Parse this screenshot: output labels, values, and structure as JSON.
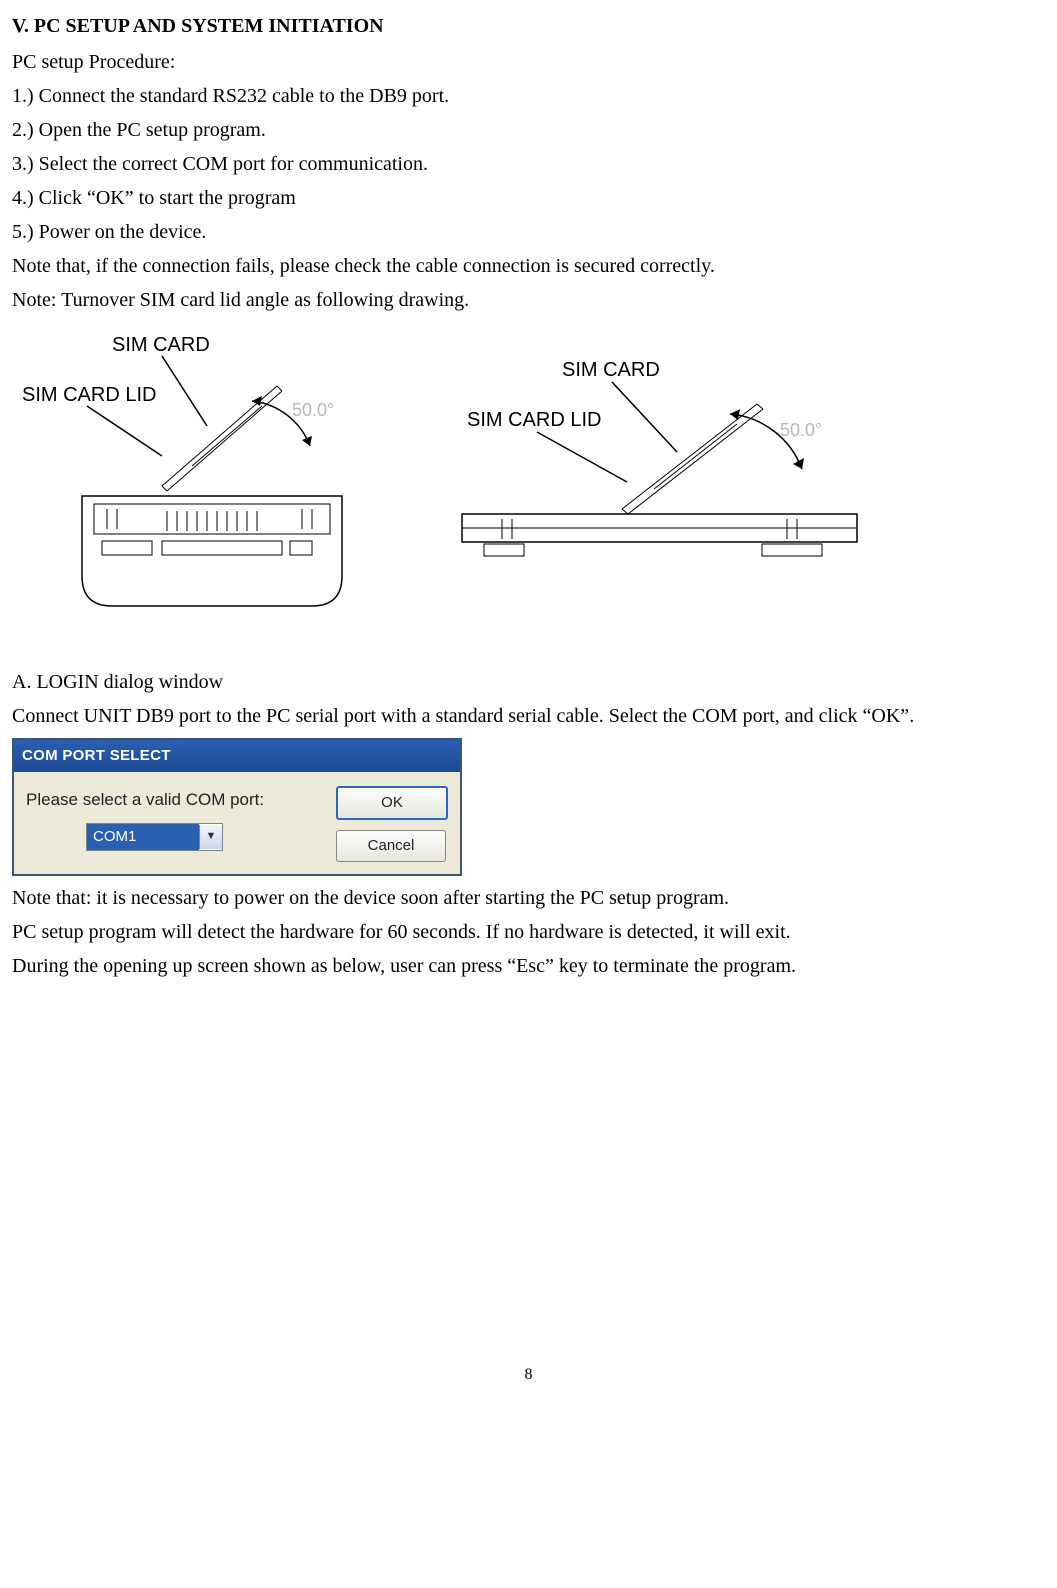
{
  "heading": "V. PC SETUP AND SYSTEM INITIATION",
  "procedure_label": "PC setup Procedure:",
  "steps": {
    "s1": "1.) Connect the standard RS232 cable to the DB9 port.",
    "s2": "2.) Open the PC setup program.",
    "s3": "3.) Select the correct COM port for communication.",
    "s4": "4.) Click “OK” to start the program",
    "s5": "5.) Power on the device."
  },
  "note1": "Note that, if the connection fails, please check the cable connection is secured correctly.",
  "note2": "Note: Turnover SIM card lid angle as following drawing.",
  "diagram_labels": {
    "sim_card": "SIM CARD",
    "sim_card_lid": "SIM CARD LID",
    "angle": "50.0°"
  },
  "sectionA_heading": "A. LOGIN dialog window",
  "sectionA_text": "Connect UNIT DB9 port to the PC serial port with a standard serial cable. Select the COM port, and click “OK”.",
  "dialog": {
    "title": "COM PORT SELECT",
    "prompt": "Please select a valid COM port:",
    "selected": "COM1",
    "ok": "OK",
    "cancel": "Cancel"
  },
  "after1": "Note that: it is necessary to power on the device soon after starting the PC setup program.",
  "after2": "PC setup program will detect the hardware for 60 seconds. If no hardware is detected, it will exit.",
  "after3": "During the opening up screen shown as below, user can press “Esc” key to terminate the program.",
  "page_number": "8"
}
